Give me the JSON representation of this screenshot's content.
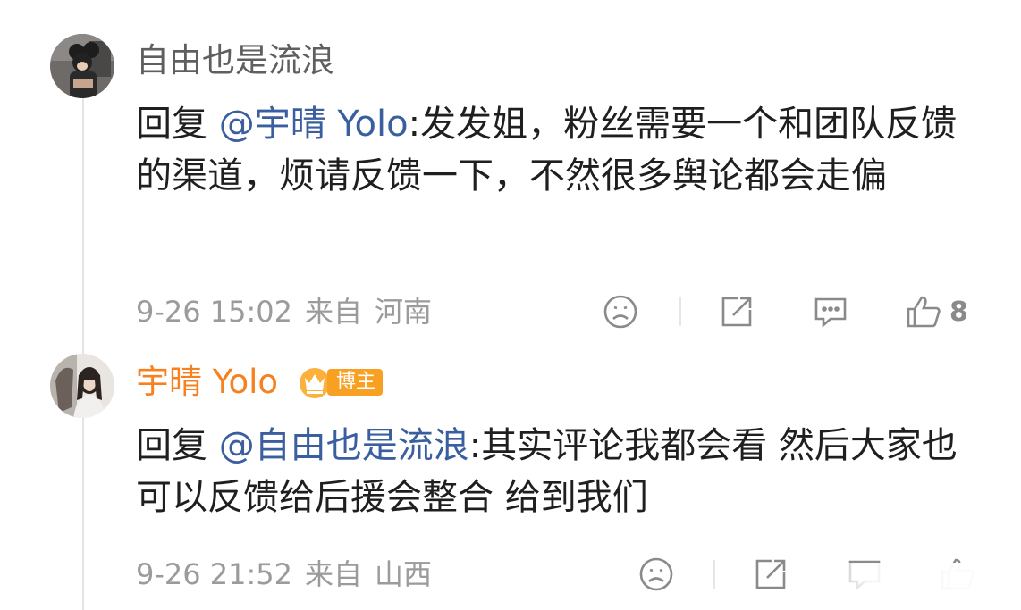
{
  "comments": [
    {
      "username": "自由也是流浪",
      "reply_prefix": "回复",
      "mention": "@宇晴 Yolo",
      "colon": ":",
      "text": "发发姐，粉丝需要一个和团队反馈的渠道，烦请反馈一下，不然很多舆论都会走偏",
      "time": "9-26 15:02",
      "from_label": "来自",
      "location": "河南",
      "likes": "8"
    },
    {
      "username": "宇晴 Yolo",
      "badge": "博主",
      "reply_prefix": "回复",
      "mention": "@自由也是流浪",
      "colon": ":",
      "text": "其实评论我都会看 然后大家也可以反馈给后援会整合 给到我们",
      "time": "9-26 21:52",
      "from_label": "来自",
      "location": "山西"
    }
  ],
  "icons": {
    "dislike": "frown-face-icon",
    "share": "share-icon",
    "comment": "comment-icon",
    "like": "thumbs-up-icon",
    "badge": "crown-icon"
  },
  "colors": {
    "mention": "#3a5f9e",
    "author_name": "#f5821f",
    "badge": "#f7a021",
    "meta": "#9b9b9b"
  }
}
